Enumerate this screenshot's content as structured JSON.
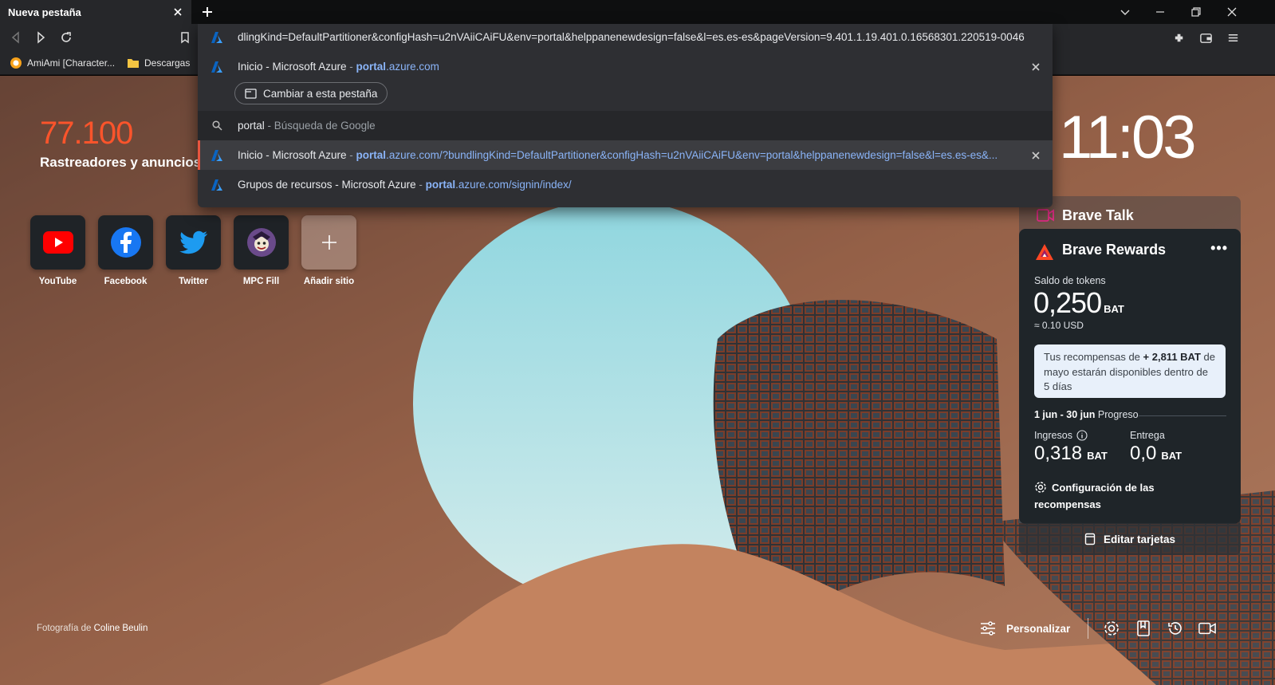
{
  "tab": {
    "title": "Nueva pestaña"
  },
  "omnibox": {
    "input_text": "dlingKind=DefaultPartitioner&configHash=u2nVAiiCAiFU&env=portal&helppanenewdesign=false&l=es.es-es&pageVersion=9.401.1.19.401.0.16568301.220519-0046",
    "suggestions": [
      {
        "title": "Inicio - Microsoft Azure",
        "sep": " - ",
        "url_bold": "portal",
        "url_rest": ".azure.com",
        "action": "Cambiar a esta pestaña"
      },
      {
        "query": "portal",
        "desc": " - Búsqueda de Google"
      },
      {
        "title": "Inicio - Microsoft Azure",
        "sep": " - ",
        "url_bold": "portal",
        "url_rest": ".azure.com/?bundlingKind=DefaultPartitioner&configHash=u2nVAiiCAiFU&env=portal&helppanenewdesign=false&l=es.es-es&..."
      },
      {
        "title": "Grupos de recursos - Microsoft Azure",
        "sep": " - ",
        "url_bold": "portal",
        "url_rest": ".azure.com/signin/index/"
      }
    ]
  },
  "bookmarks": [
    {
      "label": "AmiAmi [Character...",
      "icon": "amiami-icon"
    },
    {
      "label": "Descargas",
      "icon": "folder-icon"
    }
  ],
  "stats": {
    "count": "77.100",
    "label": "Rastreadores y anuncios"
  },
  "clock": "11:03",
  "top_sites": [
    {
      "name": "YouTube"
    },
    {
      "name": "Facebook"
    },
    {
      "name": "Twitter"
    },
    {
      "name": "MPC Fill"
    },
    {
      "name": "Añadir sitio"
    }
  ],
  "brave_talk": {
    "title": "Brave Talk"
  },
  "rewards": {
    "title": "Brave Rewards",
    "menu": "•••",
    "balance_label": "Saldo de tokens",
    "balance": "0,250",
    "balance_unit": "BAT",
    "usd": "≈ 0.10 USD",
    "notice_pre": "Tus recompensas de ",
    "notice_amount": "+ 2,811 BAT",
    "notice_post": " de mayo estarán disponibles dentro de 5 días",
    "period": "1 jun - 30 jun",
    "period_suffix": " Progreso",
    "income_label": "Ingresos",
    "income": "0,318",
    "income_unit": "BAT",
    "delivery_label": "Entrega",
    "delivery": "0,0",
    "delivery_unit": "BAT",
    "settings": "Configuración de las recompensas"
  },
  "edit_cards": "Editar tarjetas",
  "credit": {
    "prefix": "Fotografía de ",
    "name": "Coline Beulin"
  },
  "customize": "Personalizar",
  "colors": {
    "brave_orange": "#fb542b",
    "link_blue": "#8ab4f8",
    "panel_dark": "#1f2529"
  }
}
